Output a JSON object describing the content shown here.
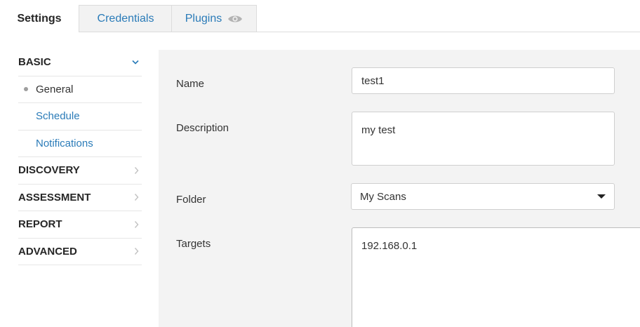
{
  "tabs": [
    {
      "label": "Settings",
      "active": true
    },
    {
      "label": "Credentials",
      "active": false
    },
    {
      "label": "Plugins",
      "active": false,
      "icon": "eye-icon"
    }
  ],
  "sidebar": {
    "items": [
      {
        "label": "BASIC",
        "type": "section",
        "icon": "chevron-down-icon",
        "expanded": true
      },
      {
        "label": "General",
        "type": "sub",
        "active": true
      },
      {
        "label": "Schedule",
        "type": "sub"
      },
      {
        "label": "Notifications",
        "type": "sub"
      },
      {
        "label": "DISCOVERY",
        "type": "section",
        "icon": "chevron-right-icon"
      },
      {
        "label": "ASSESSMENT",
        "type": "section",
        "icon": "chevron-right-icon"
      },
      {
        "label": "REPORT",
        "type": "section",
        "icon": "chevron-right-icon"
      },
      {
        "label": "ADVANCED",
        "type": "section",
        "icon": "chevron-right-icon"
      }
    ]
  },
  "form": {
    "name": {
      "label": "Name",
      "value": "test1"
    },
    "description": {
      "label": "Description",
      "value": "my test"
    },
    "folder": {
      "label": "Folder",
      "value": "My Scans"
    },
    "targets": {
      "label": "Targets",
      "value": "192.168.0.1"
    }
  },
  "colors": {
    "link": "#2a7bb8",
    "panel": "#f3f3f3",
    "tab_inactive": "#f2f2f2"
  }
}
